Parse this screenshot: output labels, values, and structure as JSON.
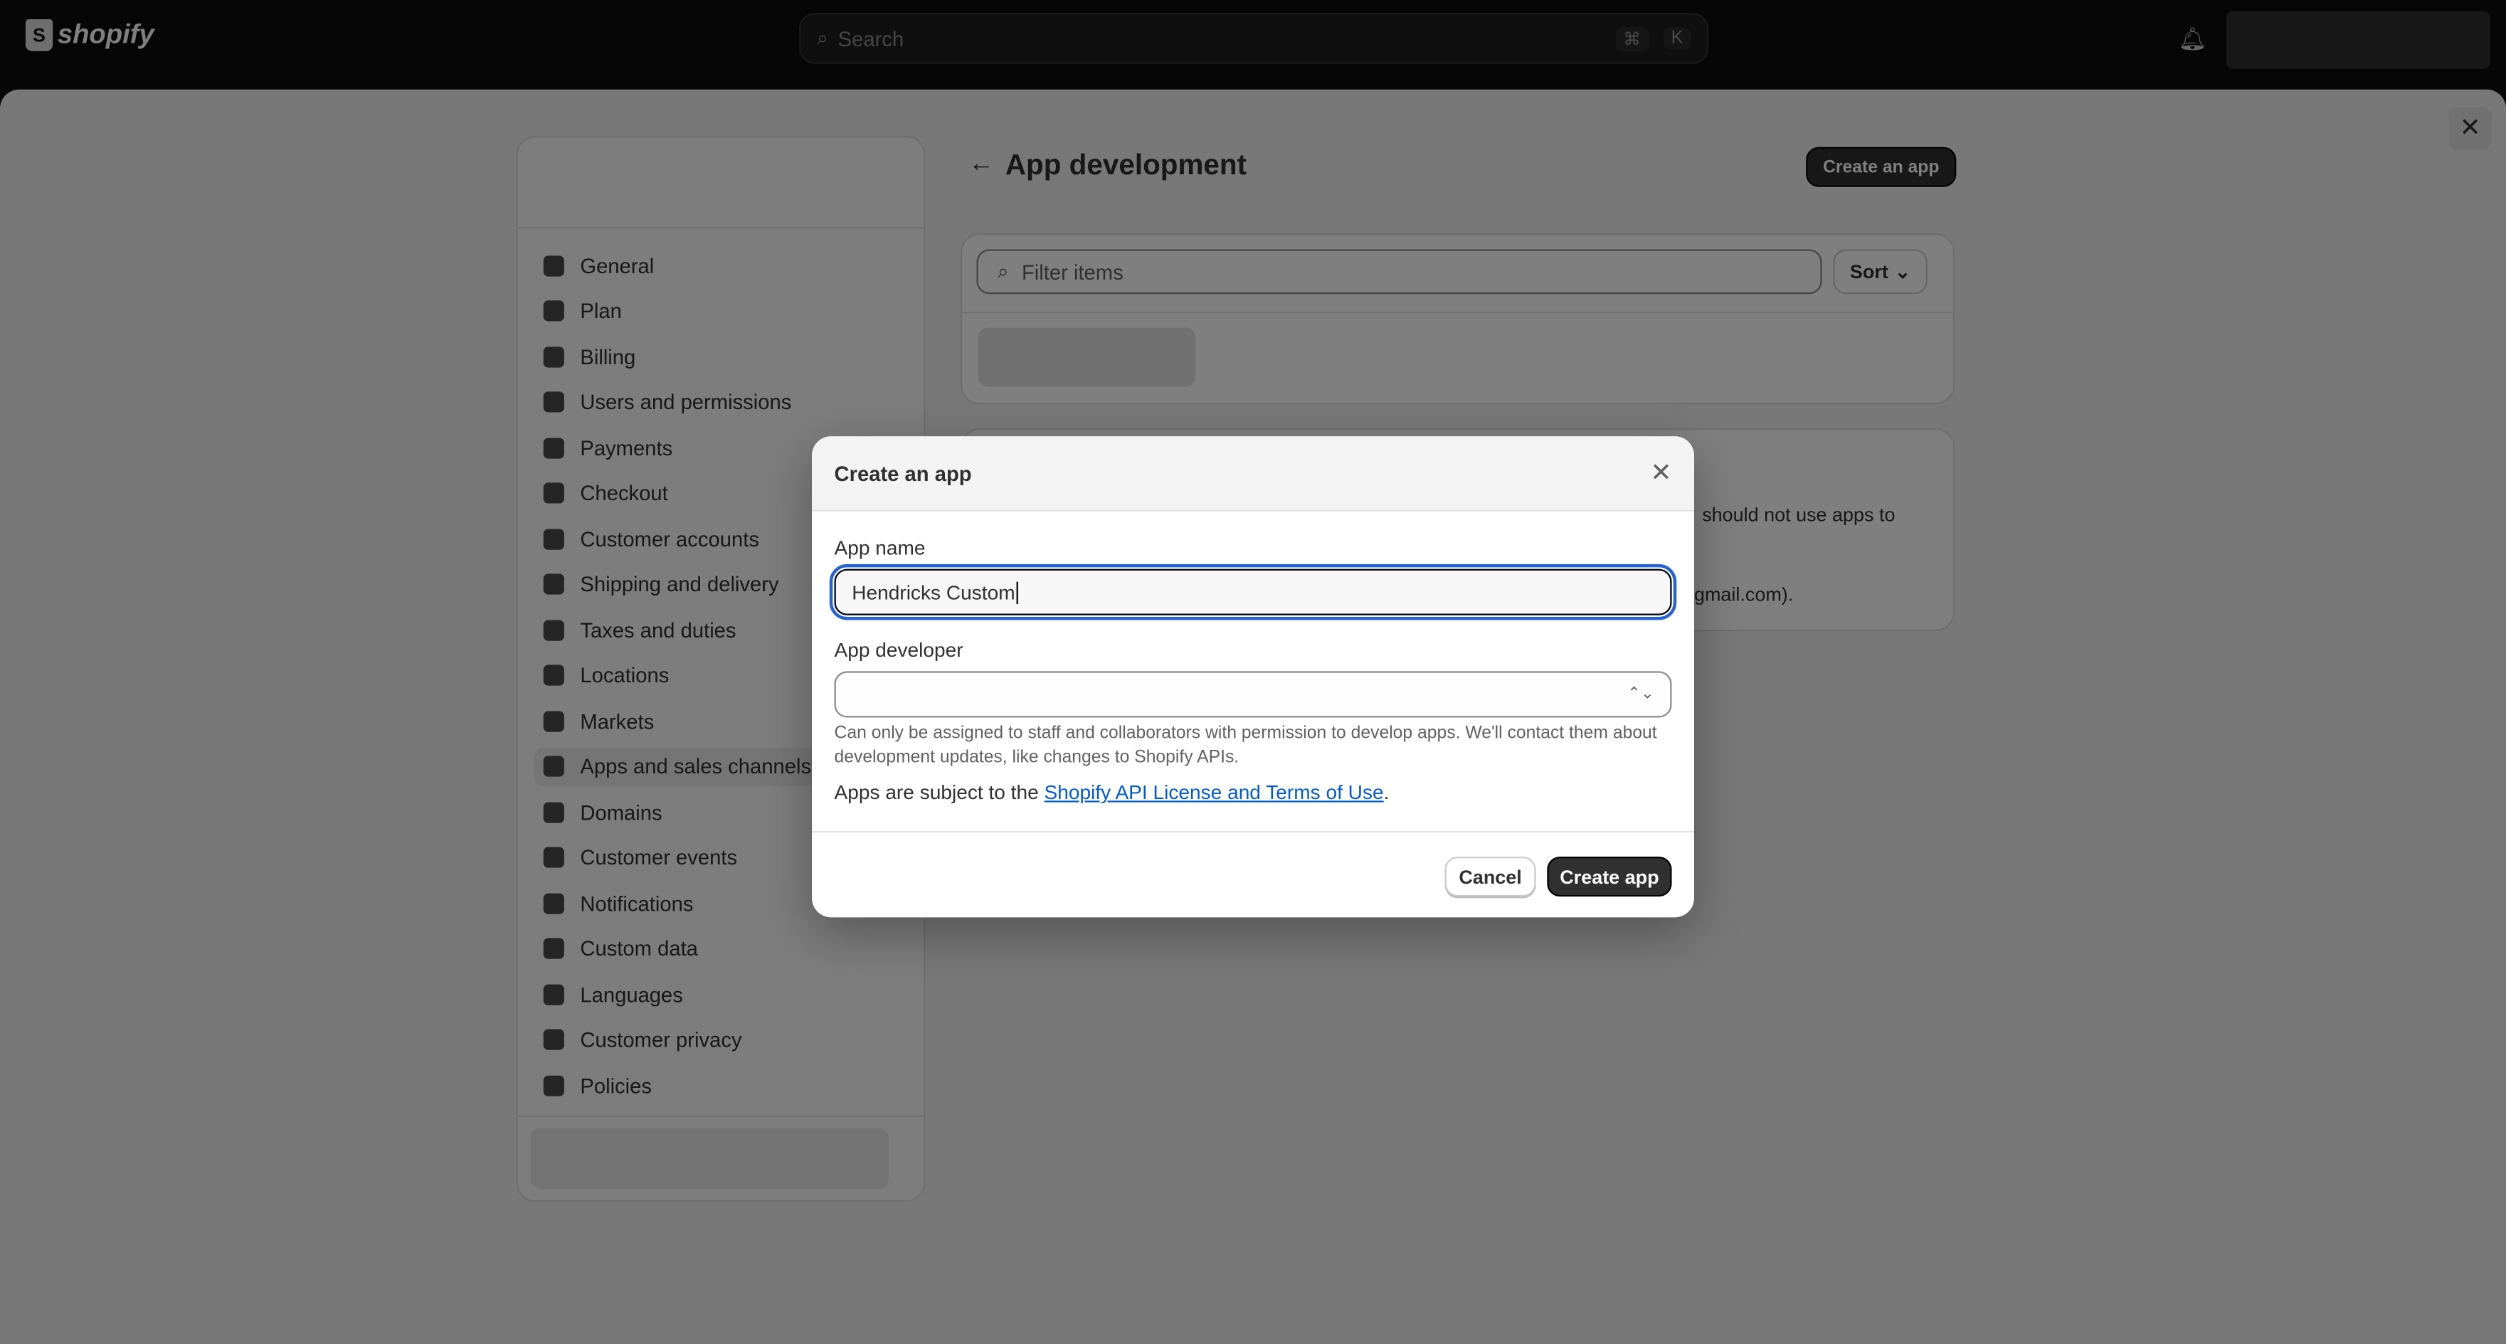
{
  "topbar": {
    "logo": "shopify",
    "search_placeholder": "Search",
    "shortcut": [
      "⌘",
      "K"
    ]
  },
  "sidebar": {
    "items": [
      {
        "label": "General",
        "icon": "store-icon"
      },
      {
        "label": "Plan",
        "icon": "plan-icon"
      },
      {
        "label": "Billing",
        "icon": "billing-icon"
      },
      {
        "label": "Users and permissions",
        "icon": "users-icon"
      },
      {
        "label": "Payments",
        "icon": "payments-icon"
      },
      {
        "label": "Checkout",
        "icon": "cart-icon"
      },
      {
        "label": "Customer accounts",
        "icon": "person-icon"
      },
      {
        "label": "Shipping and delivery",
        "icon": "truck-icon"
      },
      {
        "label": "Taxes and duties",
        "icon": "tax-icon"
      },
      {
        "label": "Locations",
        "icon": "location-icon"
      },
      {
        "label": "Markets",
        "icon": "globe-icon"
      },
      {
        "label": "Apps and sales channels",
        "icon": "apps-icon",
        "selected": true
      },
      {
        "label": "Domains",
        "icon": "domain-icon"
      },
      {
        "label": "Customer events",
        "icon": "events-icon"
      },
      {
        "label": "Notifications",
        "icon": "bell-icon"
      },
      {
        "label": "Custom data",
        "icon": "data-icon"
      },
      {
        "label": "Languages",
        "icon": "language-icon"
      },
      {
        "label": "Customer privacy",
        "icon": "lock-icon"
      },
      {
        "label": "Policies",
        "icon": "policy-icon"
      }
    ]
  },
  "main": {
    "title": "App development",
    "create_button": "Create an app",
    "filter_placeholder": "Filter items",
    "sort_label": "Sort",
    "card_text_1": "should not use apps to",
    "card_text_2": "gmail.com)."
  },
  "modal": {
    "title": "Create an app",
    "app_name_label": "App name",
    "app_name_value": "Hendricks Custom",
    "app_developer_label": "App developer",
    "app_developer_value": "",
    "help_text": "Can only be assigned to staff and collaborators with permission to develop apps. We'll contact them about development updates, like changes to Shopify APIs.",
    "terms_prefix": "Apps are subject to the ",
    "terms_link": "Shopify API License and Terms of Use",
    "terms_suffix": ".",
    "cancel": "Cancel",
    "submit": "Create app"
  },
  "colors": {
    "primary_button": "#303030",
    "focus_ring": "#2563d9",
    "link": "#005bd3"
  }
}
